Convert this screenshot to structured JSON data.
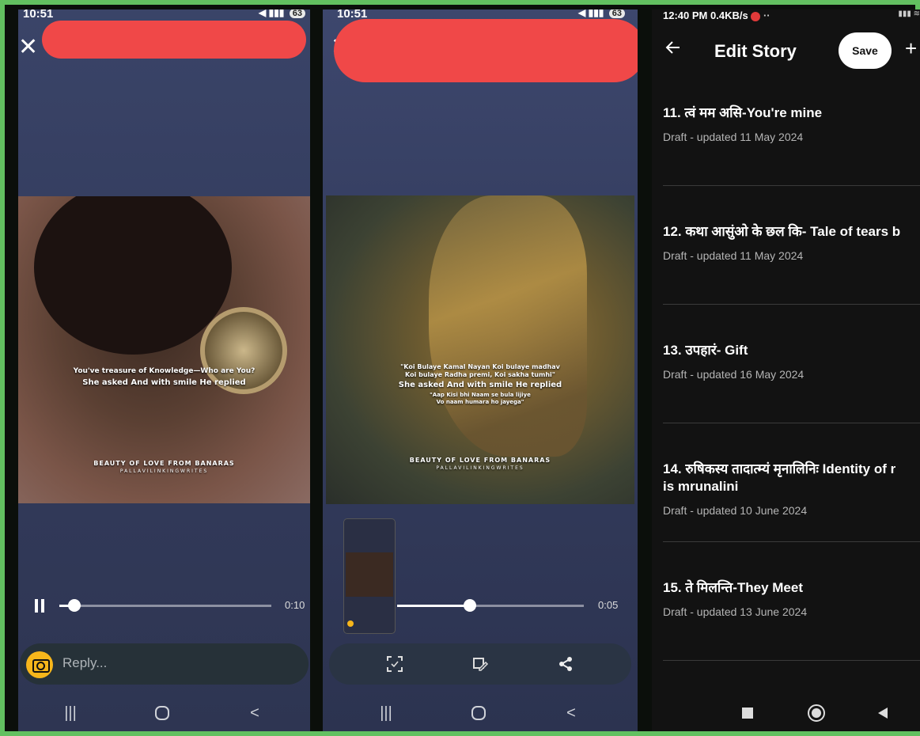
{
  "panel1": {
    "status_time": "10:51",
    "status_badge": "63",
    "caption_line1": "You've treasure of Knowledge—Who are You?",
    "caption_line2": "She asked And with smile He replied",
    "footer_title": "BEAUTY OF LOVE FROM BANARAS",
    "footer_sub": "PALLAVILINKINGWRITES",
    "duration": "0:10",
    "progress": 0.07,
    "reply_placeholder": "Reply..."
  },
  "panel2": {
    "status_time": "10:51",
    "status_badge": "63",
    "caption_line1": "\"Koi Bulaye Kamal Nayan Koi bulaye madhav",
    "caption_line2": "Koi bulaye Radha premi, Koi sakha tumhi\"",
    "caption_line3": "She asked And with smile He replied",
    "caption_line4": "\"Aap Kisi bhi Naam se bula lijiye",
    "caption_line5": "Vo naam humara ho jayega\"",
    "footer_title": "BEAUTY OF LOVE FROM BANARAS",
    "footer_sub": "PALLAVILINKINGWRITES",
    "duration": "0:05",
    "progress": 0.39
  },
  "panel3": {
    "status_time": "12:40 PM",
    "status_speed": "0.4KB/s",
    "header_title": "Edit Story",
    "save_label": "Save",
    "items": [
      {
        "title": "11. त्वं मम असि-You're mine",
        "subtitle": "Draft - updated 11 May 2024"
      },
      {
        "title": "12. कथा आसुंओ के छल कि- Tale of tears b",
        "subtitle": "Draft - updated 11 May 2024"
      },
      {
        "title": "13. उपहारं- Gift",
        "subtitle": "Draft - updated 16 May 2024"
      },
      {
        "title": "14. रुषिकस्य तादात्म्यं मृनालिनिः Identity of r",
        "title2": "is mrunalini",
        "subtitle": "Draft - updated 10 June 2024"
      },
      {
        "title": "15. ते मिलन्ति-They Meet",
        "subtitle": "Draft - updated 13 June 2024"
      }
    ]
  },
  "colors": {
    "border_green": "#62c060",
    "redaction": "#f04848",
    "camera_yellow": "#f7b61b"
  }
}
